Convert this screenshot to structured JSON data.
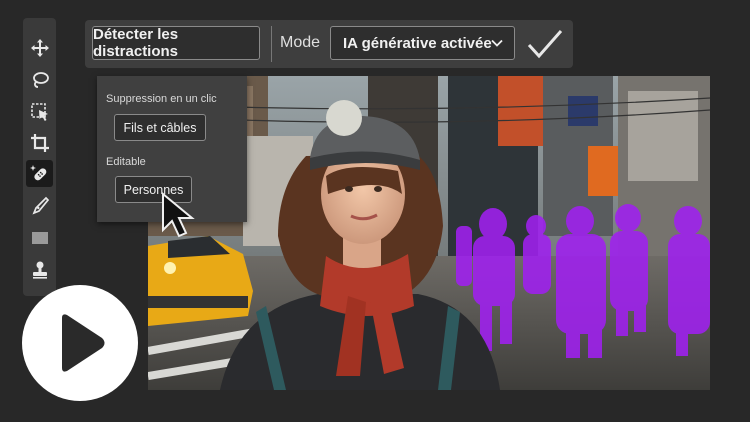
{
  "toolbar": {
    "detect_label": "Détecter les distractions",
    "mode_label": "Mode",
    "mode_value": "IA générative activée",
    "icons": {
      "chevron": "chevron-down-icon",
      "confirm": "checkmark-icon"
    }
  },
  "tools": [
    "move-icon",
    "lasso-icon",
    "object-select-icon",
    "crop-icon",
    "healing-brush-icon",
    "pen-icon",
    "rectangle-icon",
    "stamp-icon"
  ],
  "popover": {
    "section1_title": "Suppression en un clic",
    "wires_button": "Fils et câbles",
    "section2_title": "Editable",
    "people_button": "Personnes"
  },
  "colors": {
    "accent_highlight": "#a020f0",
    "panel": "#3e3e3e",
    "background": "#282828"
  },
  "play": {
    "icon": "play-icon"
  }
}
